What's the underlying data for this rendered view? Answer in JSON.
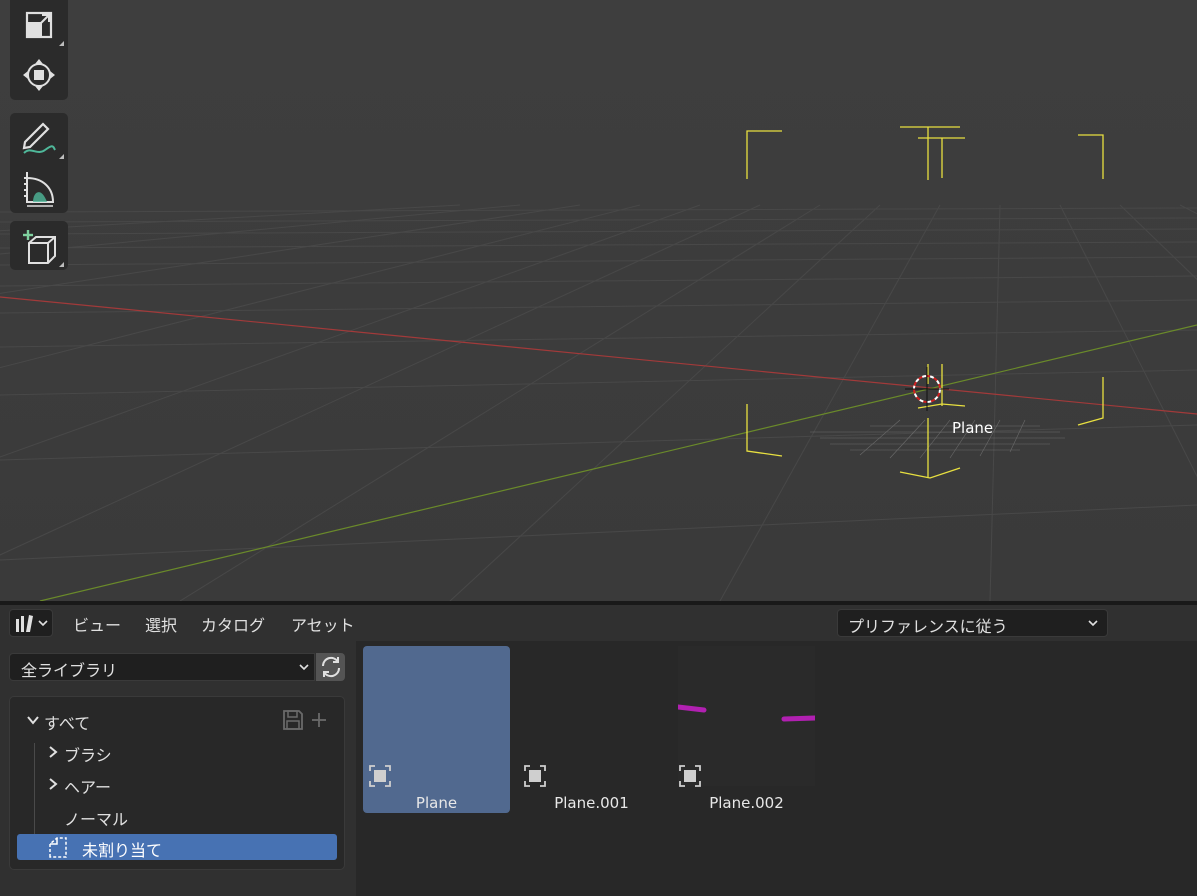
{
  "viewport": {
    "object_label": "Plane",
    "tools": [
      {
        "name": "scale-tool"
      },
      {
        "name": "transform-tool"
      },
      {
        "name": "annotate-tool"
      },
      {
        "name": "measure-tool"
      },
      {
        "name": "add-cube-tool"
      }
    ]
  },
  "asset_browser": {
    "menu": [
      "ビュー",
      "選択",
      "カタログ",
      "アセット"
    ],
    "import_method": "プリファレンスに従う",
    "library": "全ライブラリ",
    "catalog_tree": {
      "root": "すべて",
      "items": [
        "ブラシ",
        "ヘアー",
        "ノーマル"
      ],
      "unassigned": "未割り当て"
    },
    "assets": [
      {
        "name": "Plane",
        "selected": true
      },
      {
        "name": "Plane.001",
        "selected": false
      },
      {
        "name": "Plane.002",
        "selected": false
      }
    ]
  },
  "colors": {
    "accent": "#4772b3",
    "selection_tile": "#51698f",
    "x_axis": "#a23a3a",
    "y_axis": "#6a8a2a",
    "selection_outline": "#e8e040"
  }
}
